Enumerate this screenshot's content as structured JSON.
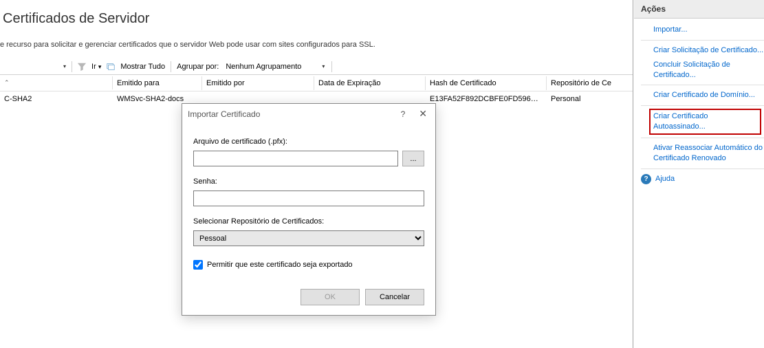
{
  "page": {
    "title": "Certificados de Servidor",
    "description": "e recurso para solicitar e gerenciar certificados que o servidor Web pode usar com sites configurados para SSL."
  },
  "toolbar": {
    "go": "Ir",
    "show_all": "Mostrar Tudo",
    "group_by_label": "Agrupar por:",
    "group_by_value": "Nenhum Agrupamento"
  },
  "grid": {
    "columns": {
      "name": "",
      "issued_to": "Emitido para",
      "issued_by": "Emitido por",
      "expiration": "Data de Expiração",
      "hash": "Hash de Certificado",
      "repo": "Repositório de Ce"
    },
    "rows": [
      {
        "name": "C-SHA2",
        "issued_to": "WMSvc-SHA2-docs",
        "issued_by": "",
        "expiration": "",
        "hash": "E13FA52F892DCBFE0FD596C5...",
        "repo": "Personal"
      }
    ]
  },
  "actions": {
    "title": "Ações",
    "import": "Importar...",
    "create_request": "Criar Solicitação de Certificado...",
    "complete_request": "Concluir Solicitação de Certificado...",
    "create_domain": "Criar Certificado de Domínio...",
    "create_self_signed": "Criar Certificado Autoassinado...",
    "enable_rebind": "Ativar Reassociar Automático do Certificado Renovado",
    "help": "Ajuda"
  },
  "dialog": {
    "title": "Importar Certificado",
    "file_label": "Arquivo de certificado (.pfx):",
    "file_value": "",
    "browse": "...",
    "password_label": "Senha:",
    "password_value": "",
    "store_label": "Selecionar Repositório de Certificados:",
    "store_value": "Pessoal",
    "allow_export_label": "Permitir que este certificado seja exportado",
    "ok": "OK",
    "cancel": "Cancelar"
  }
}
